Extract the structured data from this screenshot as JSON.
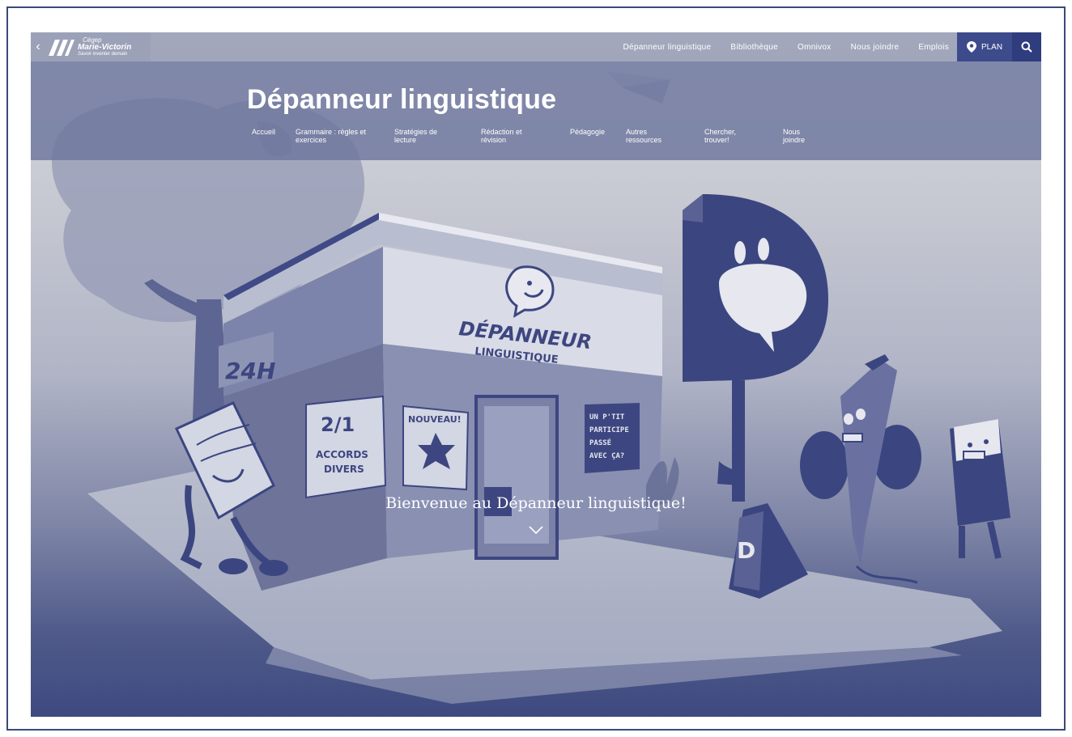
{
  "header": {
    "logo": {
      "line1": "Cégep",
      "line2": "Marie-Victorin",
      "line3": "Savoir inventer demain"
    },
    "top_nav": [
      {
        "label": "Dépanneur linguistique"
      },
      {
        "label": "Bibliothèque"
      },
      {
        "label": "Omnivox"
      },
      {
        "label": "Nous joindre"
      },
      {
        "label": "Emplois"
      }
    ],
    "plan_label": "PLAN"
  },
  "site": {
    "title": "Dépanneur linguistique",
    "sub_nav": [
      {
        "label": "Accueil"
      },
      {
        "label": "Grammaire : règles et exercices"
      },
      {
        "label": "Stratégies de lecture"
      },
      {
        "label": "Rédaction et révision"
      },
      {
        "label": "Pédagogie"
      },
      {
        "label": "Autres ressources"
      },
      {
        "label": "Chercher, trouver!"
      },
      {
        "label": "Nous joindre"
      }
    ]
  },
  "hero": {
    "welcome": "Bienvenue au Dépanneur linguistique!",
    "store_sign_line1": "DÉPANNEUR",
    "store_sign_line2": "LINGUISTIQUE",
    "sign_24h": "24H",
    "poster_left_line1": "2/1",
    "poster_left_line2": "ACCORDS",
    "poster_left_line3": "DIVERS",
    "poster_mid": "NOUVEAU!",
    "poster_right_line1": "UN P'TIT",
    "poster_right_line2": "PARTICIPE",
    "poster_right_line3": "PASSÉ",
    "poster_right_line4": "AVEC ÇA?"
  },
  "colors": {
    "accent": "#3d4a8c",
    "search_bg": "#2f3c7e",
    "illustration_dark": "#3b4680",
    "illustration_mid": "#6a71a0"
  }
}
